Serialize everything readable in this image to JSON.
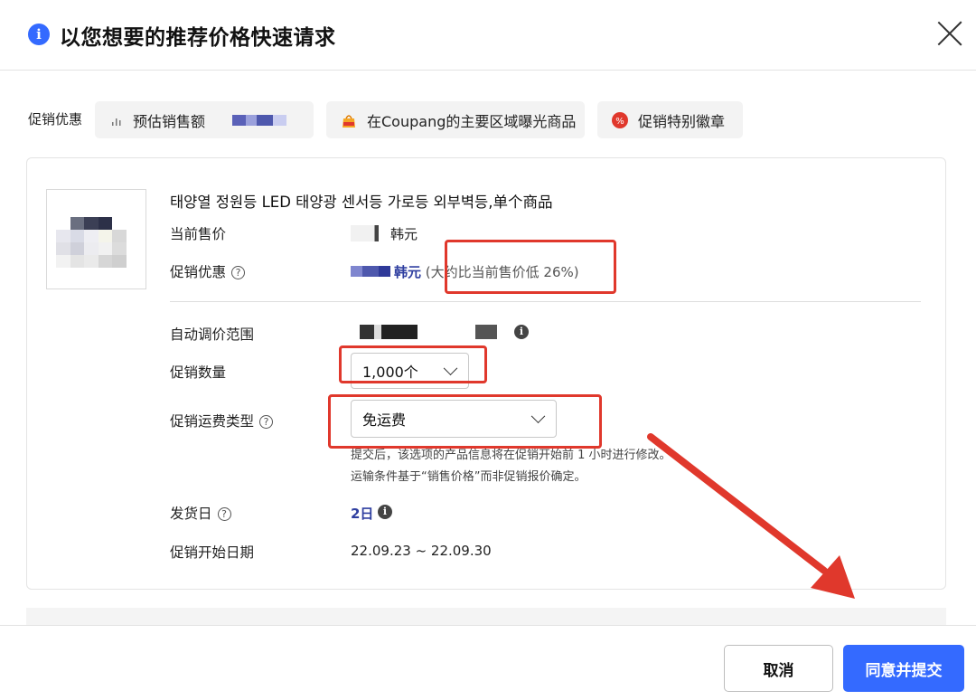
{
  "dialog": {
    "title": "以您想要的推荐价格快速请求",
    "close_icon": "close-icon"
  },
  "benefits": {
    "label": "促销优惠",
    "chips": [
      {
        "icon": "bar-chart-icon",
        "label": "预估销售额"
      },
      {
        "icon": "sale-bag-icon",
        "label": "在Coupang的主要区域曝光商品"
      },
      {
        "icon": "percent-badge-icon",
        "label": "促销特别徽章"
      }
    ]
  },
  "product": {
    "name": "태양열 정원등 LED 태양광 센서등 가로등 외부벽등,单个商品",
    "current_price_label": "当前售价",
    "current_price_unit": "韩元",
    "promo_benefit_label": "促销优惠",
    "promo_price_unit": "韩元",
    "promo_discount_note": "(大约比当前售价低 26%)",
    "auto_range_label": "自动调价范围",
    "quantity_label": "促销数量",
    "quantity_value": "1,000个",
    "shipping_type_label": "促销运费类型",
    "shipping_type_value": "免运费",
    "shipping_note_1": "提交后，该选项的产品信息将在促销开始前 1 小时进行修改。",
    "shipping_note_2": "运输条件基于“销售价格”而非促销报价确定。",
    "delivery_label": "发货日",
    "delivery_value": "2日",
    "start_date_label": "促销开始日期",
    "start_date_value": "22.09.23 ~ 22.09.30"
  },
  "footer": {
    "cancel_label": "取消",
    "agree_label": "同意并提交"
  },
  "colors": {
    "primary": "#346aff",
    "annotation_red": "#e0382c",
    "accent_text": "#2f3fa0"
  }
}
